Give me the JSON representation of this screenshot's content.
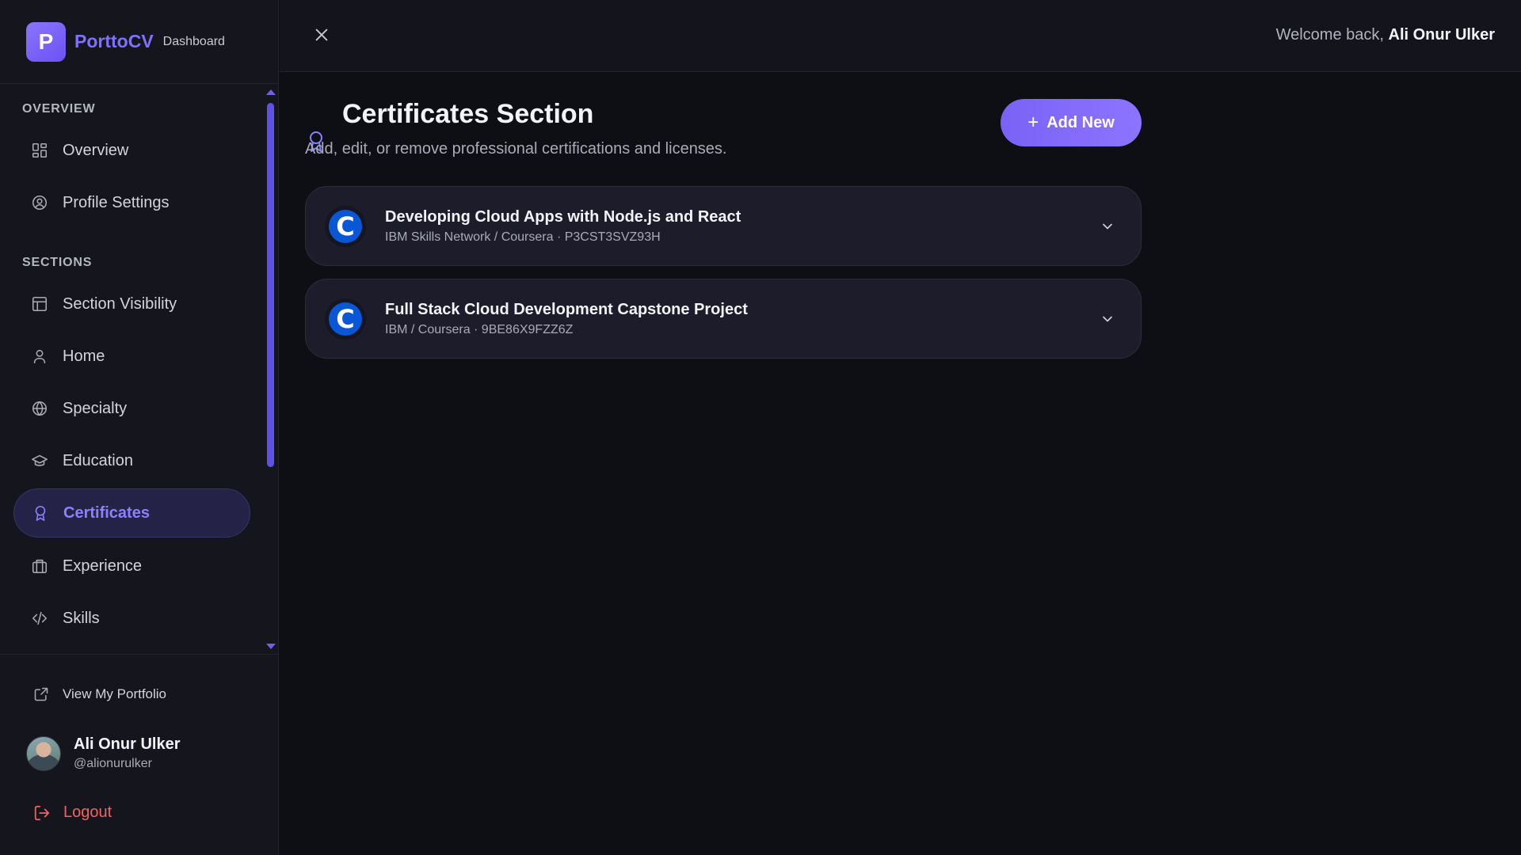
{
  "brand": {
    "name": "PorttoCV",
    "logo_letter": "P",
    "subtitle": "Dashboard"
  },
  "sidebar": {
    "overview_heading": "OVERVIEW",
    "sections_heading": "SECTIONS",
    "items": [
      {
        "label": "Overview",
        "icon": "grid-icon"
      },
      {
        "label": "Profile Settings",
        "icon": "user-circle-icon"
      },
      {
        "label": "Section Visibility",
        "icon": "layout-icon"
      },
      {
        "label": "Home",
        "icon": "user-icon"
      },
      {
        "label": "Specialty",
        "icon": "globe-icon"
      },
      {
        "label": "Education",
        "icon": "graduation-cap-icon"
      },
      {
        "label": "Certificates",
        "icon": "award-icon",
        "active": true
      },
      {
        "label": "Experience",
        "icon": "briefcase-icon"
      },
      {
        "label": "Skills",
        "icon": "code-icon"
      }
    ],
    "view_portfolio": "View My Portfolio",
    "user": {
      "name": "Ali Onur Ulker",
      "handle": "@alionurulker"
    },
    "logout": "Logout"
  },
  "topbar": {
    "welcome_prefix": "Welcome back,",
    "user_name": "Ali Onur Ulker"
  },
  "main": {
    "title": "Certificates Section",
    "subtitle": "Add, edit, or remove professional certifications and licenses.",
    "add_button": "Add New",
    "certificates": [
      {
        "logo_letter": "C",
        "title": "Developing Cloud Apps with Node.js and React",
        "meta": "IBM Skills Network / Coursera · P3CST3SVZ93H"
      },
      {
        "logo_letter": "C",
        "title": "Full Stack Cloud Development Capstone Project",
        "meta": "IBM / Coursera · 9BE86X9FZZ6Z"
      }
    ]
  },
  "colors": {
    "accent": "#7f70ff",
    "danger": "#f26363",
    "coursera": "#0a57d6"
  }
}
